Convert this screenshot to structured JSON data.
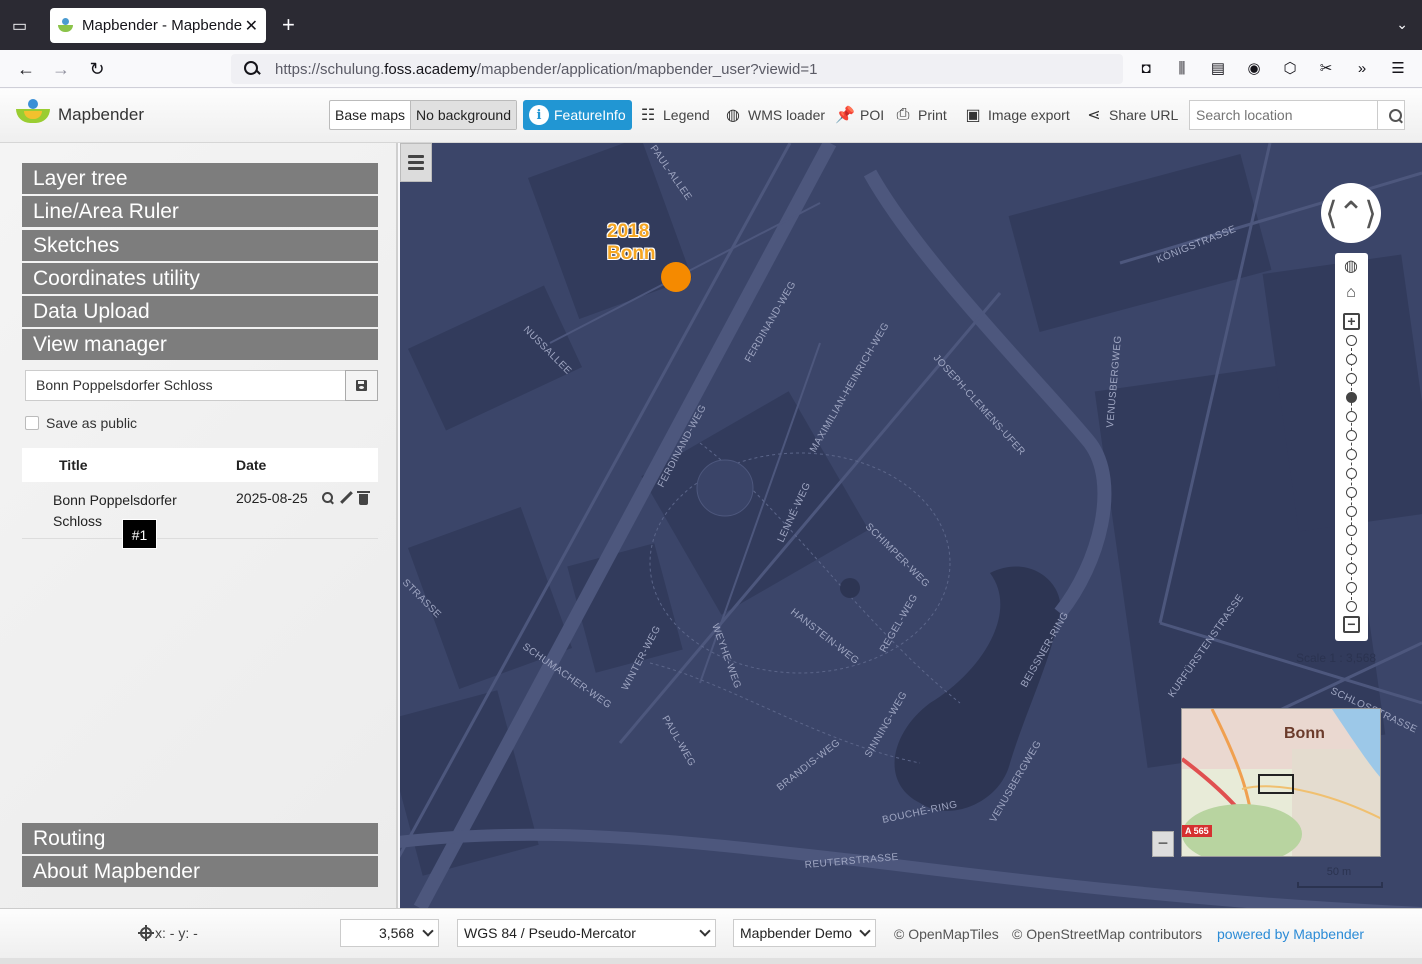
{
  "browser": {
    "tab_title": "Mapbender - Mapbende",
    "url_prefix": "https://schulung.",
    "url_domain": "foss.academy",
    "url_path": "/mapbender/application/mapbender_user?viewid=1"
  },
  "header": {
    "app_title": "Mapbender",
    "base_maps": "Base maps",
    "no_background": "No background",
    "tools": {
      "featureinfo": "FeatureInfo",
      "legend": "Legend",
      "wms_loader": "WMS loader",
      "poi": "POI",
      "print": "Print",
      "image_export": "Image export",
      "share_url": "Share URL"
    },
    "search_placeholder": "Search location"
  },
  "sidebar": {
    "accordion": [
      "Layer tree",
      "Line/Area Ruler",
      "Sketches",
      "Coordinates utility",
      "Data Upload",
      "View manager"
    ],
    "view_manager": {
      "input_value": "Bonn Poppelsdorfer Schloss",
      "save_public_label": "Save as public",
      "col_title": "Title",
      "col_date": "Date",
      "rows": [
        {
          "title": "Bonn Poppelsdorfer Schloss",
          "date": "2025-08-25"
        }
      ],
      "tooltip": "#1"
    },
    "bottom_accordion": [
      "Routing",
      "About Mapbender"
    ]
  },
  "map": {
    "poi_label_line1": "2018",
    "poi_label_line2": "Bonn",
    "scale_text": "Scale 1 : 3,568",
    "scalebar_label": "50 m",
    "overview_title": "Bonn",
    "overview_badge": "A 565",
    "streets": [
      "NUSSALLEE",
      "FERDINAND-WEG",
      "MAXIMILIAN-HEINRICH-WEG",
      "JOSEPH-CLEMENS-UFER",
      "VENUSBERGWEG",
      "KÖNIGSTRASSE",
      "LENNÉ-WEG",
      "SCHIMPER-WEG",
      "FERDINAND-WEG",
      "WEYHE-WEG",
      "HANSTEIN-WEG",
      "REGEL-WEG",
      "BEISSNER-RING",
      "WINTER-WEG",
      "SCHUMACHER-WEG",
      "PAUL-WEG",
      "SINNING-WEG",
      "BRANDIS-WEG",
      "BOUCHÉ-RING",
      "VENUSBERGWEG",
      "KURFÜRSTENSTRASSE",
      "SCHLOSSTRASSE",
      "REUTERSTRASSE",
      "PAUL-ALLEE",
      "STRASSE"
    ]
  },
  "footer": {
    "coords": "x: - y: -",
    "scale_select": "3,568",
    "srs_select": "WGS 84 / Pseudo-Mercator",
    "app_select": "Mapbender Demo",
    "attr_openmaptiles": "© OpenMapTiles",
    "attr_osm": "© OpenStreetMap contributors",
    "powered_by": "powered by Mapbender"
  },
  "colors": {
    "accordion": "#7d7d7d",
    "featureinfo_active": "#2196d3",
    "map_background": "#3b4569",
    "poi": "#f58a00"
  }
}
